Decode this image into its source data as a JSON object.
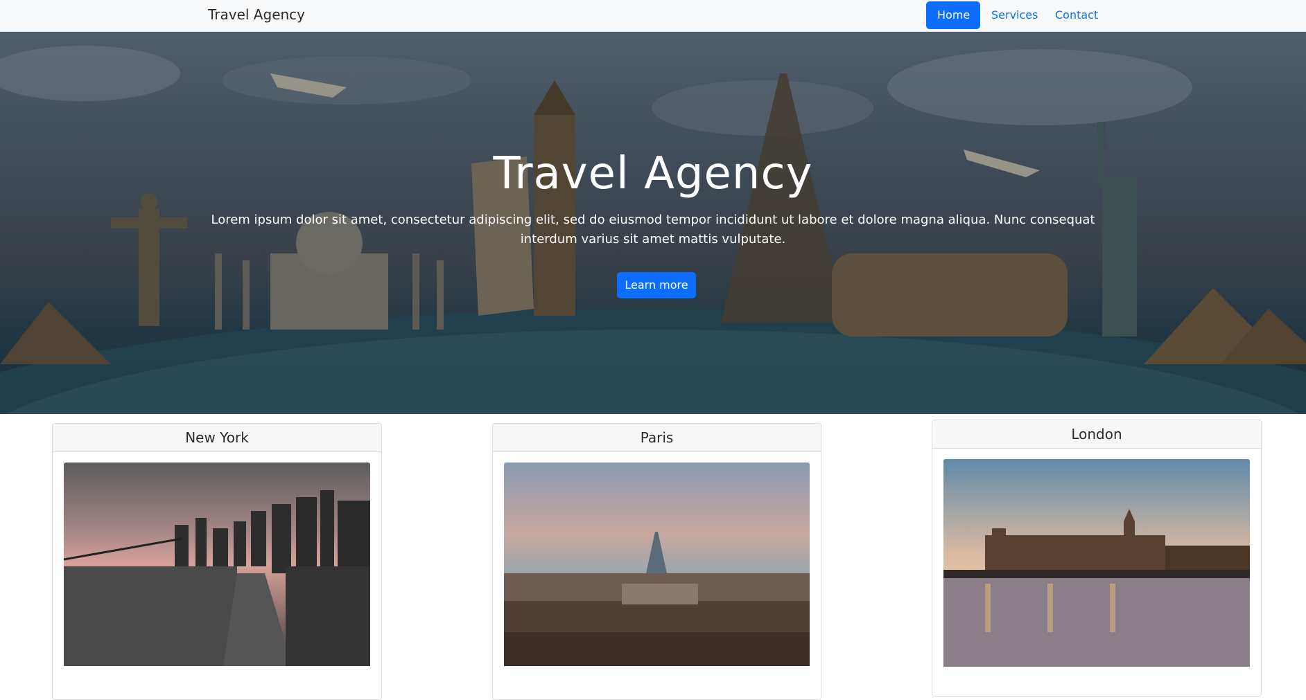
{
  "navbar": {
    "brand": "Travel Agency",
    "items": [
      {
        "label": "Home",
        "active": true
      },
      {
        "label": "Services",
        "active": false
      },
      {
        "label": "Contact",
        "active": false
      }
    ]
  },
  "hero": {
    "title": "Travel Agency",
    "text_line1": "Lorem ipsum dolor sit amet, consectetur adipiscing elit, sed do eiusmod tempor incididunt ut labore et dolore magna aliqua. Nunc consequat",
    "text_line2": "interdum varius sit amet mattis vulputate.",
    "button_label": "Learn more"
  },
  "cards": [
    {
      "title": "New York"
    },
    {
      "title": "Paris"
    },
    {
      "title": "London"
    }
  ],
  "colors": {
    "primary": "#0d6efd",
    "navbar_bg": "#f8f9fa",
    "card_header_bg": "#f7f7f7"
  }
}
